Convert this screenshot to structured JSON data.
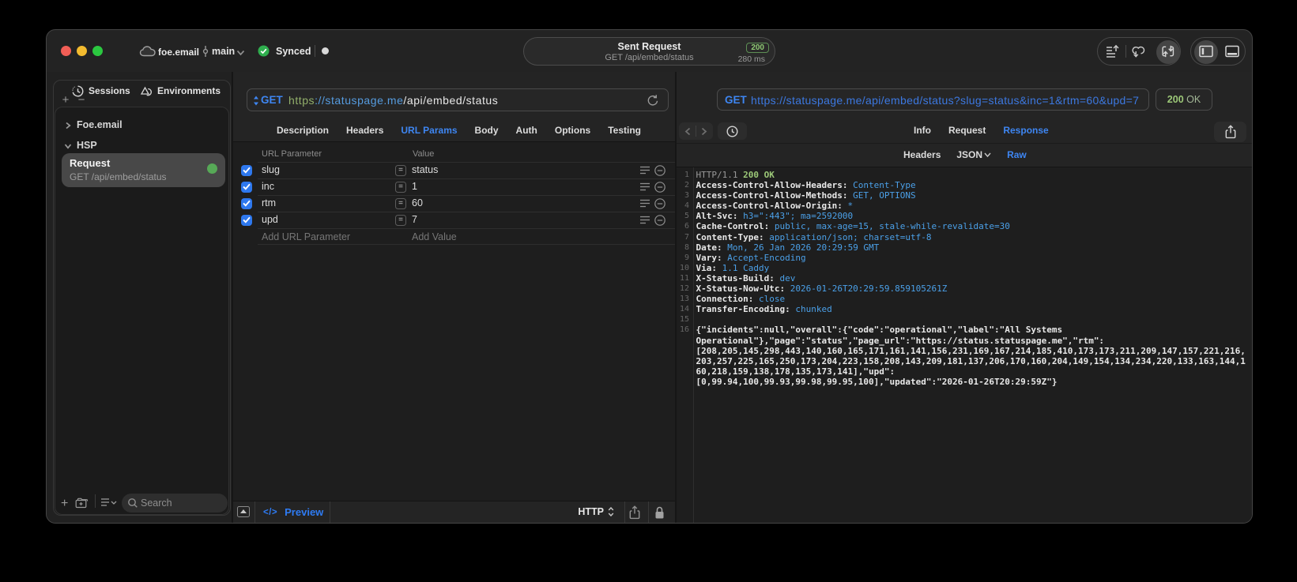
{
  "window": {
    "title_bar": {
      "traffic_lights": [
        "close",
        "minimize",
        "zoom"
      ],
      "project_name": "foe.email",
      "branch_name": "main",
      "sync_status": "Synced",
      "sent_request_popover": {
        "title": "Sent Request",
        "subtitle": "GET /api/embed/status",
        "status_code": "200",
        "duration": "280 ms"
      },
      "toolbar_icons": [
        "export-log-icon",
        "sync-link-icon",
        "import-export-icon",
        "left-panel-toggle-icon",
        "bottom-panel-toggle-icon"
      ]
    }
  },
  "sidebar": {
    "tabs": [
      {
        "label": "Sessions",
        "icon": "history-icon"
      },
      {
        "label": "Environments",
        "icon": "environments-icon"
      }
    ],
    "tree": {
      "group_collapsed": {
        "label": "Foe.email"
      },
      "group_expanded": {
        "label": "HSP"
      },
      "selected_item": {
        "title": "Request",
        "subtitle": "GET /api/embed/status",
        "status_dot_color": "#57a957"
      }
    },
    "search_placeholder": "Search"
  },
  "request_editor": {
    "method": "GET",
    "url": {
      "scheme": "https",
      "host": "://statuspage.me",
      "path": "/api/embed/status"
    },
    "tabs": [
      "Description",
      "Headers",
      "URL Params",
      "Body",
      "Auth",
      "Options",
      "Testing"
    ],
    "active_tab": "URL Params",
    "params_table": {
      "columns": [
        "URL Parameter",
        "Value"
      ],
      "rows": [
        {
          "checked": true,
          "name": "slug",
          "value": "status"
        },
        {
          "checked": true,
          "name": "inc",
          "value": "1"
        },
        {
          "checked": true,
          "name": "rtm",
          "value": "60"
        },
        {
          "checked": true,
          "name": "upd",
          "value": "7"
        }
      ],
      "add_name_placeholder": "Add URL Parameter",
      "add_value_placeholder": "Add Value"
    },
    "footer": {
      "preview_label": "Preview",
      "protocol": "HTTP"
    }
  },
  "response_viewer": {
    "request_line": {
      "method": "GET",
      "url": "https://statuspage.me/api/embed/status?slug=status&inc=1&rtm=60&upd=7"
    },
    "status_badge": {
      "code": "200",
      "text": "OK"
    },
    "tabs": [
      "Info",
      "Request",
      "Response"
    ],
    "active_tab": "Response",
    "subtabs": [
      "Headers",
      "JSON",
      "Raw"
    ],
    "active_subtab": "Raw",
    "body_lines": [
      {
        "num": 1,
        "segments": [
          {
            "style": "dim",
            "text": "HTTP/1.1 "
          },
          {
            "style": "green",
            "text": "200 OK"
          }
        ]
      },
      {
        "num": 2,
        "segments": [
          {
            "style": "key",
            "text": "Access-Control-Allow-Headers:"
          },
          {
            "style": "value",
            "text": " Content-Type"
          }
        ]
      },
      {
        "num": 3,
        "segments": [
          {
            "style": "key",
            "text": "Access-Control-Allow-Methods:"
          },
          {
            "style": "value",
            "text": " GET, OPTIONS"
          }
        ]
      },
      {
        "num": 4,
        "segments": [
          {
            "style": "key",
            "text": "Access-Control-Allow-Origin:"
          },
          {
            "style": "value",
            "text": " *"
          }
        ]
      },
      {
        "num": 5,
        "segments": [
          {
            "style": "key",
            "text": "Alt-Svc:"
          },
          {
            "style": "value",
            "text": " h3=\":443\"; ma=2592000"
          }
        ]
      },
      {
        "num": 6,
        "segments": [
          {
            "style": "key",
            "text": "Cache-Control:"
          },
          {
            "style": "value",
            "text": " public, max-age=15, stale-while-revalidate=30"
          }
        ]
      },
      {
        "num": 7,
        "segments": [
          {
            "style": "key",
            "text": "Content-Type:"
          },
          {
            "style": "value",
            "text": " application/json; charset=utf-8"
          }
        ]
      },
      {
        "num": 8,
        "segments": [
          {
            "style": "key",
            "text": "Date:"
          },
          {
            "style": "value",
            "text": " Mon, 26 Jan 2026 20:29:59 GMT"
          }
        ]
      },
      {
        "num": 9,
        "segments": [
          {
            "style": "key",
            "text": "Vary:"
          },
          {
            "style": "value",
            "text": " Accept-Encoding"
          }
        ]
      },
      {
        "num": 10,
        "segments": [
          {
            "style": "key",
            "text": "Via:"
          },
          {
            "style": "value",
            "text": " 1.1 Caddy"
          }
        ]
      },
      {
        "num": 11,
        "segments": [
          {
            "style": "key",
            "text": "X-Status-Build:"
          },
          {
            "style": "value",
            "text": " dev"
          }
        ]
      },
      {
        "num": 12,
        "segments": [
          {
            "style": "key",
            "text": "X-Status-Now-Utc:"
          },
          {
            "style": "value",
            "text": " 2026-01-26T20:29:59.859105261Z"
          }
        ]
      },
      {
        "num": 13,
        "segments": [
          {
            "style": "key",
            "text": "Connection:"
          },
          {
            "style": "value",
            "text": " close"
          }
        ]
      },
      {
        "num": 14,
        "segments": [
          {
            "style": "key",
            "text": "Transfer-Encoding:"
          },
          {
            "style": "value",
            "text": " chunked"
          }
        ]
      },
      {
        "num": 15,
        "segments": []
      },
      {
        "num": 16,
        "segments": [
          {
            "style": "plain",
            "text": "{\"incidents\":null,\"overall\":{\"code\":\"operational\",\"label\":\"All Systems Operational\"},\"page\":\"status\",\"page_url\":\"https://status.statuspage.me\",\"rtm\":[208,205,145,298,443,140,160,165,171,161,141,156,231,169,167,214,185,410,173,173,211,209,147,157,221,216,203,257,225,165,250,173,204,223,158,208,143,209,181,137,206,170,160,204,149,154,134,234,220,133,163,144,160,218,159,138,178,135,173,141],\"upd\":"
          },
          {
            "style": "plain nowrap",
            "text": "[0,99.94,100,99.93,99.98,99.95,100],\"updated\":\"2026-01-26T20:29:59Z\"}"
          }
        ]
      }
    ]
  },
  "colors": {
    "accent_blue": "#3e86f2",
    "value_blue": "#4ba0e8",
    "status_green": "#9cc878",
    "dot_green": "#57a957",
    "traffic_red": "#f15e56",
    "traffic_yellow": "#f3bb2f",
    "traffic_green": "#2bc840"
  }
}
